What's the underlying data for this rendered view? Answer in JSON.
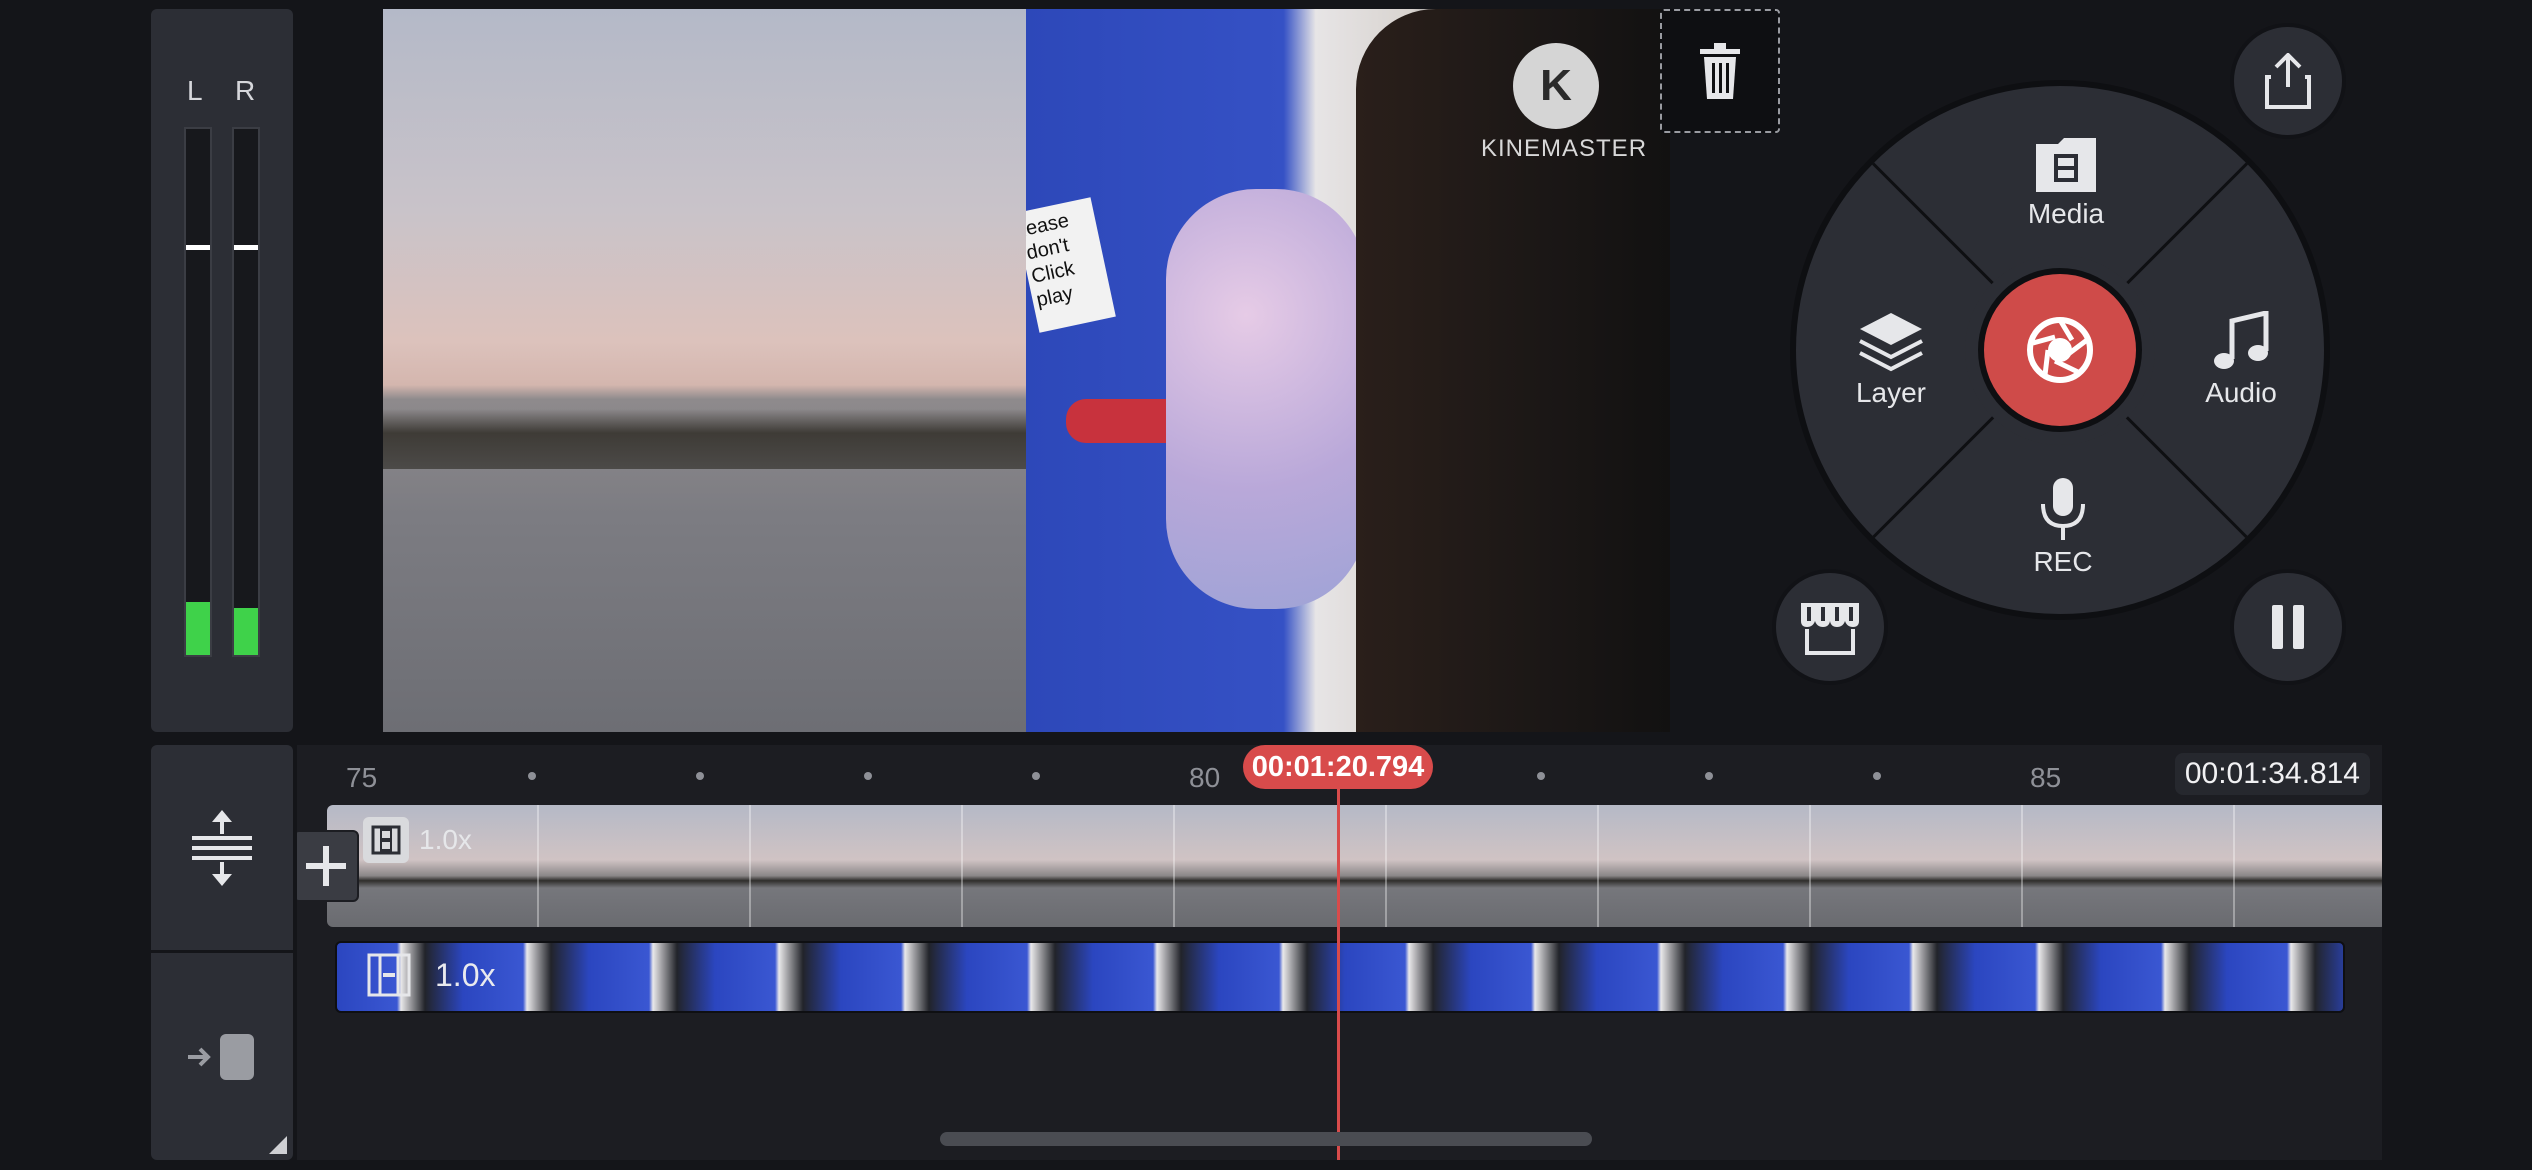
{
  "audio_meter": {
    "left_label": "L",
    "right_label": "R",
    "left_level": 0.1,
    "right_level": 0.09,
    "left_peak": 0.77,
    "right_peak": 0.77
  },
  "preview": {
    "watermark_letter": "K",
    "watermark_text": "KINEMASTER",
    "sticker_text": "lease don't Click play"
  },
  "wheel": {
    "media_label": "Media",
    "layer_label": "Layer",
    "audio_label": "Audio",
    "rec_label": "REC"
  },
  "timeline": {
    "ruler_labels": [
      "75",
      "80",
      "85"
    ],
    "playhead_time": "00:01:20.794",
    "end_time": "00:01:34.814",
    "main_clip_speed": "1.0x",
    "layer_clip_speed": "1.0x"
  },
  "icons": {
    "delete": "trash-icon",
    "share": "share-icon",
    "asset_store": "store-icon",
    "pause": "pause-icon",
    "record": "camera-shutter-icon",
    "expand": "expand-tracks-icon",
    "jump": "jump-to-start-icon",
    "add_clip": "plus-icon"
  },
  "colors": {
    "accent_red": "#cf4b49",
    "meter_green": "#3fd24a",
    "panel": "#2c2e35"
  }
}
